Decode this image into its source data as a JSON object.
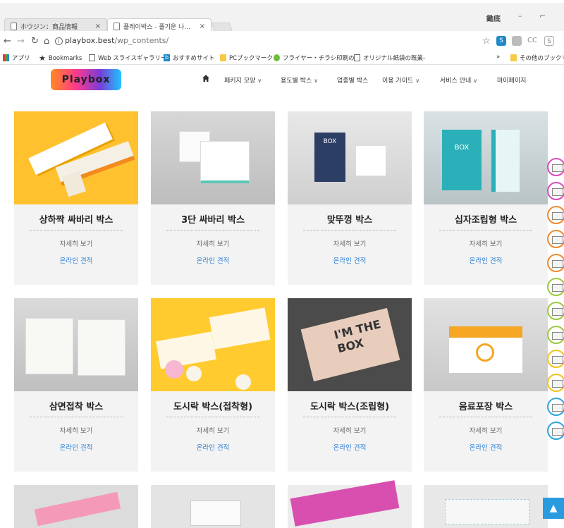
{
  "browser": {
    "tabs": [
      {
        "label": "ホウジン：商品情報",
        "active": false
      },
      {
        "label": "플레이박스 - 플기운 나...",
        "active": true
      }
    ],
    "user_label": "鋤底",
    "url_host": "playbox.best",
    "url_path": "/wp_contents/",
    "bookmarks": [
      "アプリ",
      "Bookmarks",
      "Web スライスギャラリー",
      "おすすめサイト",
      "PCブックマーク",
      "フライヤー・チラシ印刷の...",
      "オリジナル紙袋の既業-",
      "»",
      "その他のブックマーク"
    ]
  },
  "site": {
    "logo_text": "Playbox",
    "nav": [
      {
        "label": "패키지 모양",
        "has_dropdown": true
      },
      {
        "label": "용도별 박스",
        "has_dropdown": true
      },
      {
        "label": "업종별 박스",
        "has_dropdown": false
      },
      {
        "label": "이용 가이드",
        "has_dropdown": true
      },
      {
        "label": "서비스 안내",
        "has_dropdown": true
      },
      {
        "label": "마이페이지",
        "has_dropdown": false
      }
    ]
  },
  "products": [
    {
      "title": "상하짝 싸바리 박스",
      "detail": "자세히 보기",
      "quote": "온라인 견적"
    },
    {
      "title": "3단 싸바리 박스",
      "detail": "자세히 보기",
      "quote": "온라인 견적"
    },
    {
      "title": "맞뚜껑 박스",
      "detail": "자세히 보기",
      "quote": "온라인 견적"
    },
    {
      "title": "십자조립형 박스",
      "detail": "자세히 보기",
      "quote": "온라인 견적"
    },
    {
      "title": "삼면접착 박스",
      "detail": "자세히 보기",
      "quote": "온라인 견적"
    },
    {
      "title": "도시락 박스(접착형)",
      "detail": "자세히 보기",
      "quote": "온라인 견적"
    },
    {
      "title": "도시락 박스(조립형)",
      "detail": "자세히 보기",
      "quote": "온라인 견적"
    },
    {
      "title": "음료포장 박스",
      "detail": "자세히 보기",
      "quote": "온라인 견적"
    }
  ],
  "image_text": {
    "box": "BOX",
    "im_the_box": "I'M THE BOX"
  },
  "colors": {
    "link": "#2b7fd6",
    "accent_blue": "#2b9be0",
    "card_bg": "#f3f3f3"
  }
}
